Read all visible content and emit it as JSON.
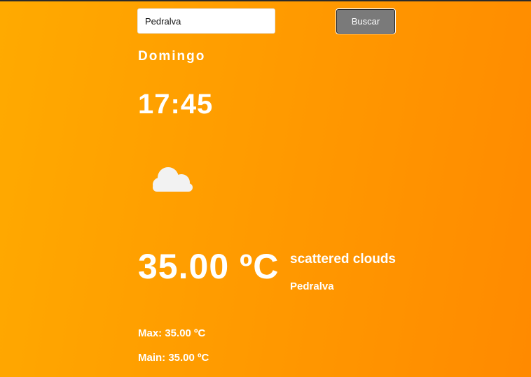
{
  "search": {
    "value": "Pedralva",
    "button_label": "Buscar"
  },
  "weather": {
    "day": "Domingo",
    "time": "17:45",
    "icon": "cloud-icon",
    "temperature": "35.00 ºC",
    "description": "scattered clouds",
    "city": "Pedralva",
    "max": "Max: 35.00 ºC",
    "main": "Main: 35.00 ºC"
  },
  "colors": {
    "background_start": "#ffaa00",
    "background_end": "#ff8a00",
    "button": "#7a7a7a",
    "text": "#ffffff",
    "icon": "#f2f2f2"
  }
}
